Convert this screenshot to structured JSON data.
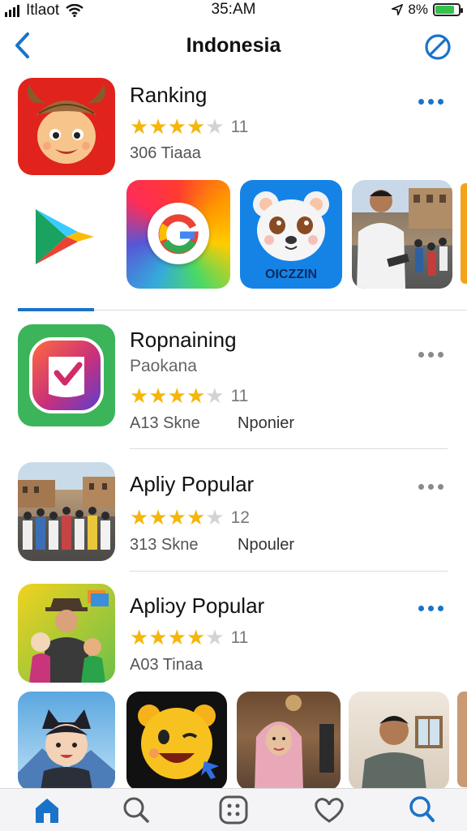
{
  "status": {
    "carrier": "Itlaot",
    "time": "35:AM",
    "battery": "8%",
    "battery_level": 0.9
  },
  "nav": {
    "title": "Indonesia"
  },
  "featured": {
    "title": "Ranking",
    "rating": 4,
    "count": "11",
    "meta": "306 Tiaaa",
    "carousel": {
      "bear_label": "OICZZIN"
    }
  },
  "rows": [
    {
      "title": "Ropnaining",
      "sub": "Paokana",
      "rating": 4,
      "count": "11",
      "meta": "A13 Skne",
      "meta2": "Nponier"
    },
    {
      "title": "Apliy Popular",
      "rating": 4,
      "count": "12",
      "meta": "313 Skne",
      "meta2": "Npouler"
    },
    {
      "title": "Apliɔy Popular",
      "rating": 4,
      "count": "11",
      "meta": "A03 Tinaa"
    }
  ],
  "tabs": [
    "home",
    "search",
    "apps",
    "hearts",
    "search-profile"
  ],
  "colors": {
    "accent": "#1a73c9",
    "star": "#f5b50a"
  }
}
